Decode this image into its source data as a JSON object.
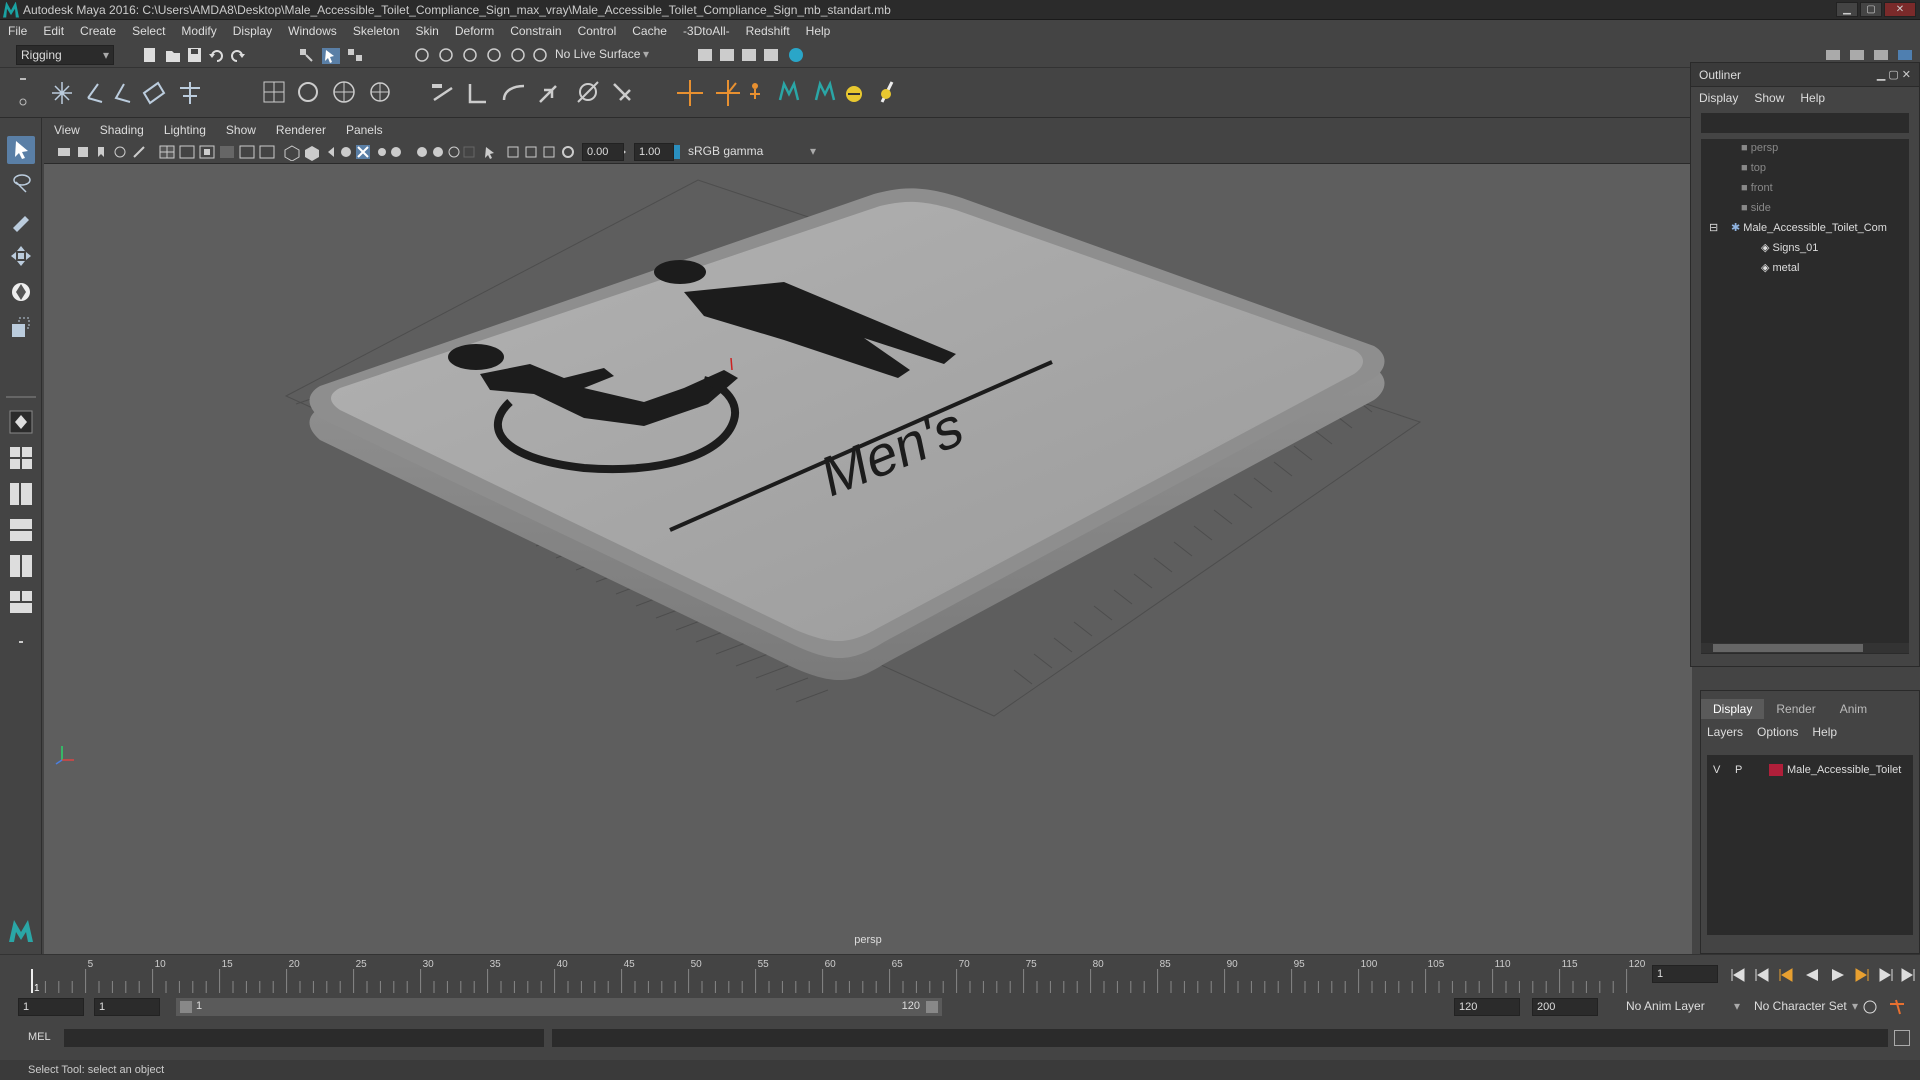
{
  "window": {
    "title": "Autodesk Maya 2016: C:\\Users\\AMDA8\\Desktop\\Male_Accessible_Toilet_Compliance_Sign_max_vray\\Male_Accessible_Toilet_Compliance_Sign_mb_standart.mb"
  },
  "menubar": [
    "File",
    "Edit",
    "Create",
    "Select",
    "Modify",
    "Display",
    "Windows",
    "Skeleton",
    "Skin",
    "Deform",
    "Constrain",
    "Control",
    "Cache",
    "-3DtoAll-",
    "Redshift",
    "Help"
  ],
  "shelf": {
    "menuset": "Rigging",
    "live_surface": "No Live Surface"
  },
  "panel": {
    "menus": [
      "View",
      "Shading",
      "Lighting",
      "Show",
      "Renderer",
      "Panels"
    ],
    "exposure": "0.00",
    "gamma": "1.00",
    "colorspace": "sRGB gamma",
    "camera_label": "persp"
  },
  "sign": {
    "text": "Men's",
    "plate_color": "#a7a7a7",
    "frame_color": "#8e8e8e",
    "icon_color": "#1c1c1c"
  },
  "outliner": {
    "title": "Outliner",
    "menus": [
      "Display",
      "Show",
      "Help"
    ],
    "items": [
      {
        "label": "persp",
        "icon": "camera-icon"
      },
      {
        "label": "top",
        "icon": "camera-icon"
      },
      {
        "label": "front",
        "icon": "camera-icon"
      },
      {
        "label": "side",
        "icon": "camera-icon"
      },
      {
        "label": "Male_Accessible_Toilet_Com",
        "icon": "joint-icon"
      },
      {
        "label": "Signs_01",
        "icon": "mesh-icon"
      },
      {
        "label": "metal",
        "icon": "mesh-icon"
      }
    ]
  },
  "layers": {
    "tabs": [
      "Display",
      "Render",
      "Anim"
    ],
    "menus": [
      "Layers",
      "Options",
      "Help"
    ],
    "row": {
      "v": "V",
      "p": "P",
      "name": "Male_Accessible_Toilet",
      "color": "#b01f3a"
    }
  },
  "timeline": {
    "ticks": [
      "5",
      "10",
      "15",
      "20",
      "25",
      "30",
      "35",
      "40",
      "45",
      "50",
      "55",
      "60",
      "65",
      "70",
      "75",
      "80",
      "85",
      "90",
      "95",
      "100",
      "105",
      "110",
      "115",
      "120"
    ],
    "start_label": "1",
    "current_frame": "1"
  },
  "range": {
    "start": "1",
    "playback_start": "1",
    "slider_start": "1",
    "slider_end": "120",
    "playback_end": "120",
    "end": "200",
    "anim_layer": "No Anim Layer",
    "char_set": "No Character Set"
  },
  "mel": {
    "label": "MEL"
  },
  "helpline": {
    "text": "Select Tool: select an object"
  }
}
